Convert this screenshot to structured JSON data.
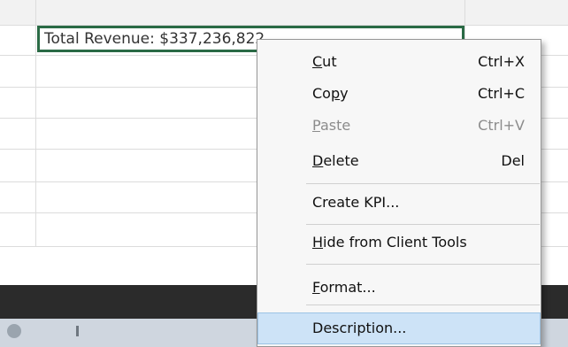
{
  "cell": {
    "text": "Total Revenue: $337,236,822"
  },
  "context_menu": {
    "items": [
      {
        "mnemonic": "C",
        "rest": "ut",
        "shortcut": "Ctrl+X",
        "enabled": true
      },
      {
        "pre": "Co",
        "mnemonic": "p",
        "rest": "y",
        "shortcut": "Ctrl+C",
        "enabled": true
      },
      {
        "mnemonic": "P",
        "rest": "aste",
        "shortcut": "Ctrl+V",
        "enabled": false
      },
      {
        "mnemonic": "D",
        "rest": "elete",
        "shortcut": "Del",
        "enabled": true
      },
      {
        "label": "Create KPI...",
        "enabled": true
      },
      {
        "mnemonic": "H",
        "rest": "ide from Client Tools",
        "enabled": true
      },
      {
        "mnemonic": "F",
        "rest": "ormat...",
        "enabled": true
      },
      {
        "label": "Description...",
        "enabled": true,
        "highlighted": true
      }
    ]
  }
}
